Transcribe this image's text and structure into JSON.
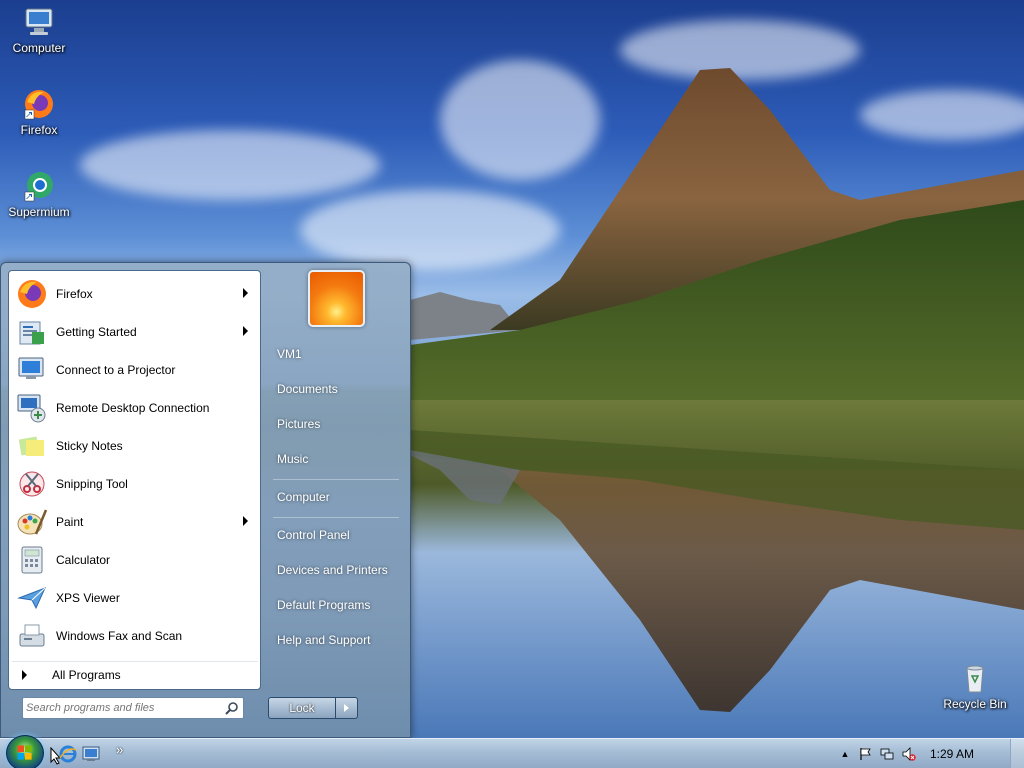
{
  "desktop": {
    "icons": [
      {
        "label": "Computer",
        "icon": "computer-icon"
      },
      {
        "label": "Firefox",
        "icon": "firefox-icon"
      },
      {
        "label": "Supermium",
        "icon": "supermium-icon"
      },
      {
        "label": "Recycle Bin",
        "icon": "recycle-bin-icon"
      }
    ]
  },
  "start_menu": {
    "programs": [
      {
        "label": "Firefox",
        "icon": "firefox-icon",
        "has_submenu": true
      },
      {
        "label": "Getting Started",
        "icon": "getting-started-icon",
        "has_submenu": true
      },
      {
        "label": "Connect to a Projector",
        "icon": "projector-icon",
        "has_submenu": false
      },
      {
        "label": "Remote Desktop Connection",
        "icon": "remote-desktop-icon",
        "has_submenu": false
      },
      {
        "label": "Sticky Notes",
        "icon": "sticky-notes-icon",
        "has_submenu": false
      },
      {
        "label": "Snipping Tool",
        "icon": "snipping-tool-icon",
        "has_submenu": false
      },
      {
        "label": "Paint",
        "icon": "paint-icon",
        "has_submenu": true
      },
      {
        "label": "Calculator",
        "icon": "calculator-icon",
        "has_submenu": false
      },
      {
        "label": "XPS Viewer",
        "icon": "xps-viewer-icon",
        "has_submenu": false
      },
      {
        "label": "Windows Fax and Scan",
        "icon": "fax-scan-icon",
        "has_submenu": false
      }
    ],
    "all_programs": "All Programs",
    "search_placeholder": "Search programs and files",
    "right_items": [
      {
        "label": "VM1"
      },
      {
        "label": "Documents"
      },
      {
        "label": "Pictures"
      },
      {
        "label": "Music"
      },
      {
        "label": "Computer"
      },
      {
        "label": "Control Panel"
      },
      {
        "label": "Devices and Printers"
      },
      {
        "label": "Default Programs"
      },
      {
        "label": "Help and Support"
      }
    ],
    "lock_label": "Lock"
  },
  "taskbar": {
    "overflow_label": "»",
    "tray_expand": "▲",
    "clock": "1:29 AM"
  },
  "colors": {
    "start_menu_glass": "#8aa6c2",
    "taskbar": "#a8bed6",
    "accent": "#3c5a7c"
  }
}
